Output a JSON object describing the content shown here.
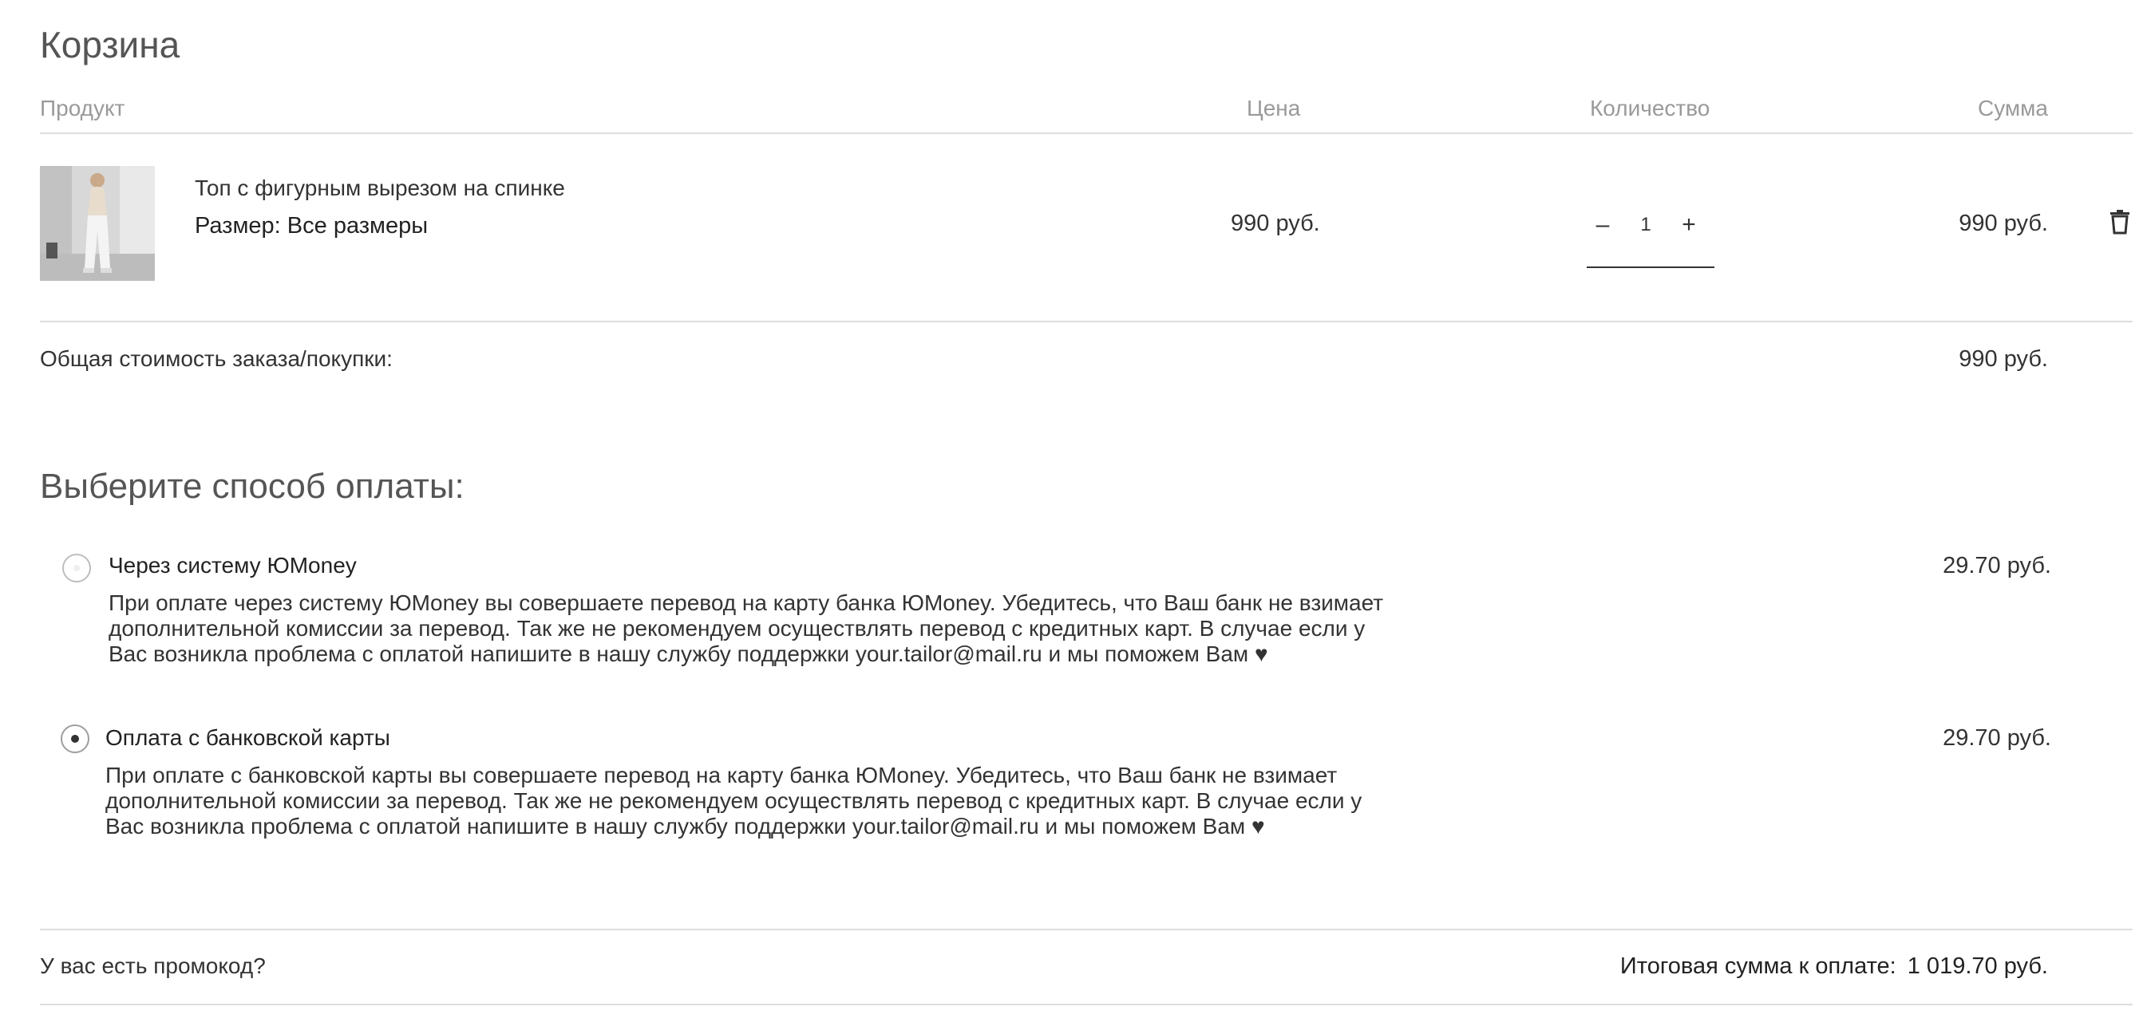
{
  "cart": {
    "title": "Корзина",
    "columns": {
      "product": "Продукт",
      "price": "Цена",
      "quantity": "Количество",
      "sum": "Сумма"
    },
    "item": {
      "name": "Топ с фигурным вырезом на спинке",
      "size_label": "Размер: Все размеры",
      "price": "990 руб.",
      "quantity_minus": "–",
      "quantity": "1",
      "quantity_plus": "+",
      "sum": "990 руб.",
      "image_icon": "product-photo",
      "delete_icon": "trash-icon"
    },
    "total_label": "Общая стоимость заказа/покупки:",
    "total_value": "990 руб."
  },
  "payment": {
    "title": "Выберите способ оплаты:",
    "options": [
      {
        "title": "Через систему ЮMoney",
        "description": "При оплате через систему ЮMoney вы совершаете перевод на карту банка ЮMoney. Убедитесь, что Ваш банк не взимает дополнительной комиссии за перевод. Так же не рекомендуем осуществлять перевод с кредитных карт. В случае если у Вас возникла проблема с оплатой напишите в нашу службу поддержки your.tailor@mail.ru и мы поможем Вам ♥",
        "fee": "29.70 руб.",
        "selected": false
      },
      {
        "title": "Оплата с банковской карты",
        "description": "При оплате с банковской карты вы совершаете перевод на карту банка ЮMoney. Убедитесь, что Ваш банк не взимает дополнительной комиссии за перевод. Так же не рекомендуем осуществлять перевод с кредитных карт. В случае если у Вас возникла проблема с оплатой напишите в нашу службу поддержки your.tailor@mail.ru и мы поможем Вам ♥",
        "fee": "29.70 руб.",
        "selected": true
      }
    ]
  },
  "footer": {
    "promo_label": "У вас есть промокод?",
    "final_label": "Итоговая сумма к оплате:",
    "final_value": "1 019.70 руб."
  }
}
